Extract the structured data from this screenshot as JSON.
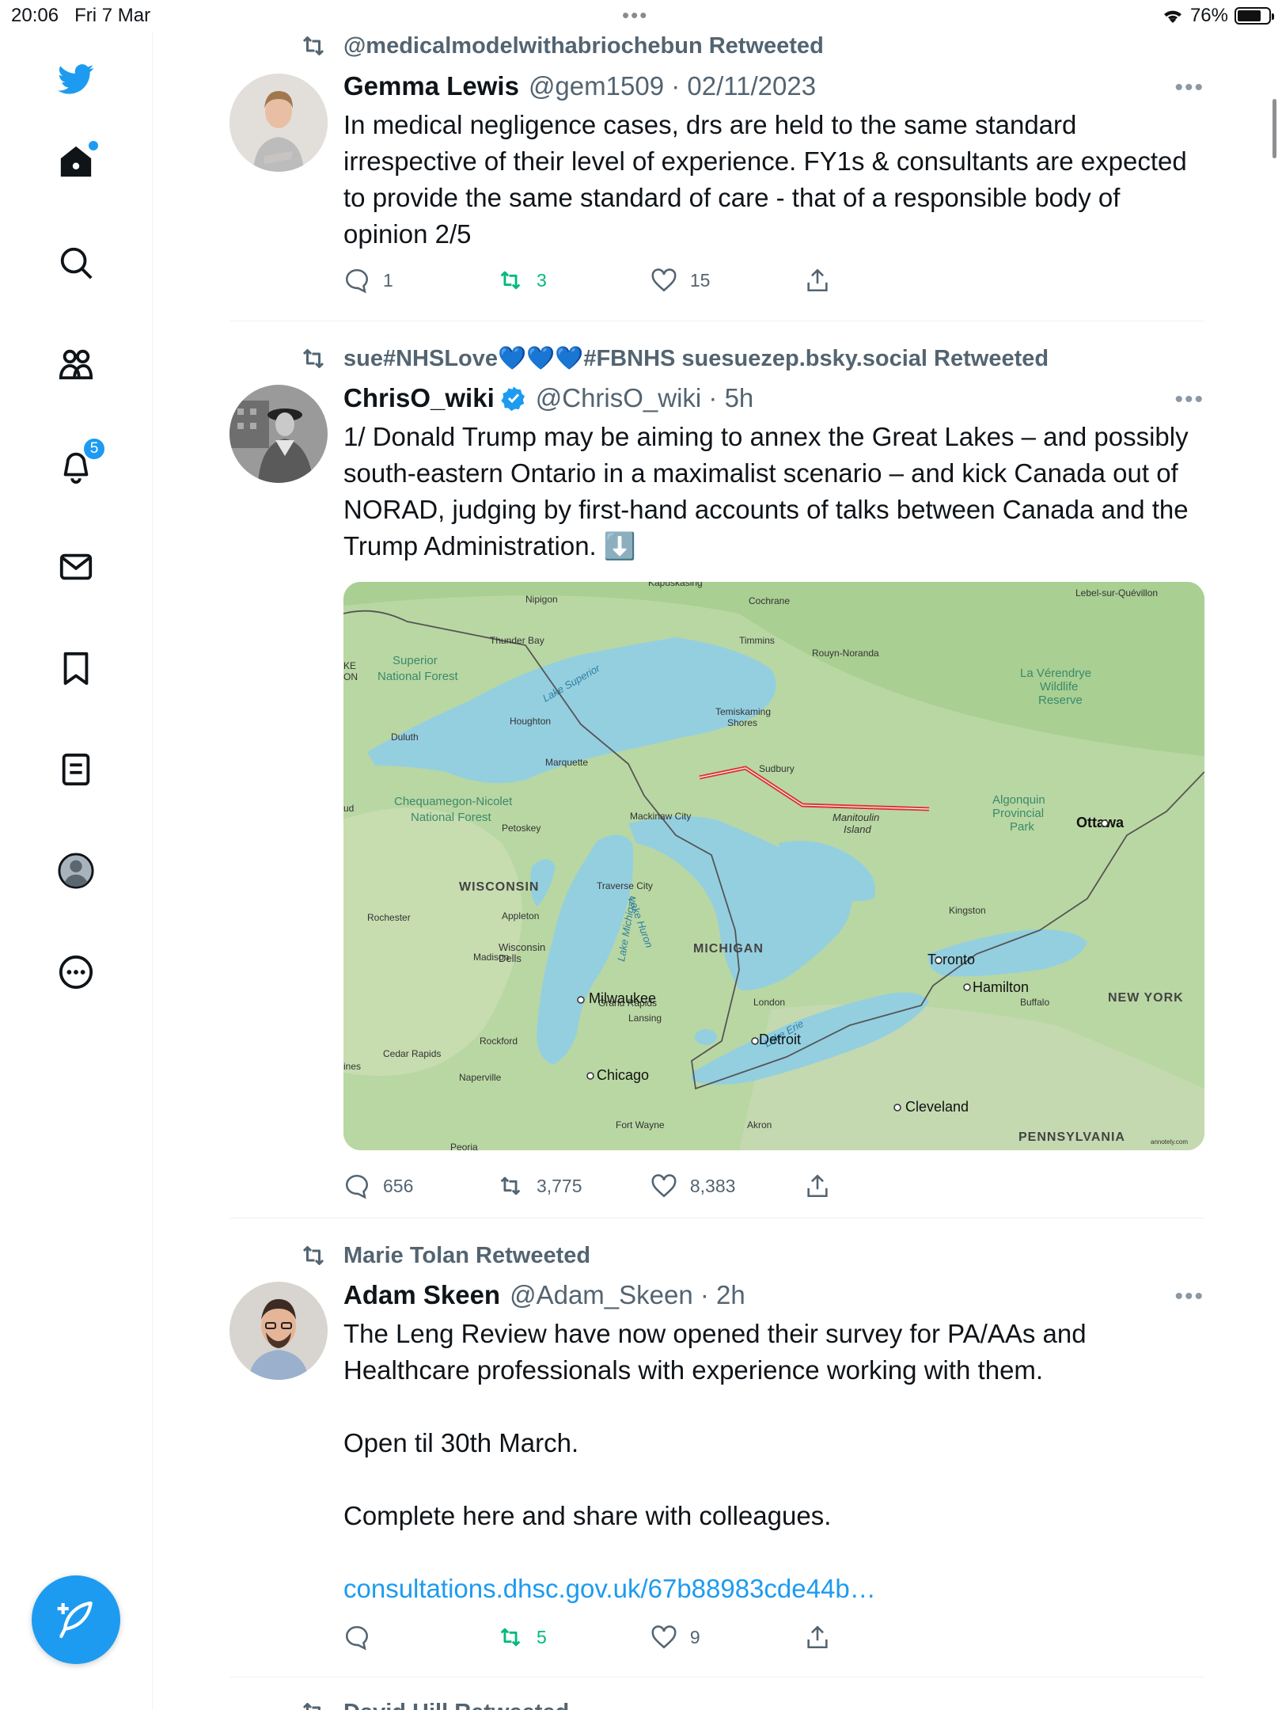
{
  "status": {
    "time": "20:06",
    "date": "Fri 7 Mar",
    "battery": "76%",
    "battery_level": 0.76
  },
  "sidebar": {
    "items": [
      {
        "name": "twitter-logo-icon"
      },
      {
        "name": "home-icon"
      },
      {
        "name": "search-icon"
      },
      {
        "name": "communities-icon"
      },
      {
        "name": "notifications-icon",
        "badge": "5"
      },
      {
        "name": "messages-icon"
      },
      {
        "name": "bookmarks-icon"
      },
      {
        "name": "lists-icon"
      },
      {
        "name": "profile-icon"
      },
      {
        "name": "more-icon"
      }
    ],
    "compose_icon": "compose-icon"
  },
  "tweets": [
    {
      "retweeted_by": "@medicalmodelwithabriochebun Retweeted",
      "name": "Gemma Lewis",
      "handle": "@gem1509 · 02/11/2023",
      "verified": false,
      "text": [
        "In medical negligence cases, drs are held to the same standard irrespective of their level of experience. FY1s & consultants are expected to provide the same standard of care - that of a responsible body of opinion 2/5"
      ],
      "replies": "1",
      "retweets": "3",
      "likes": "15"
    },
    {
      "retweeted_by": "sue#NHSLove💙💙💙#FBNHS suesuezep.bsky.social Retweeted",
      "name": "ChrisO_wiki",
      "handle": "@ChrisO_wiki · 5h",
      "verified": true,
      "text": [
        "1/ Donald Trump may be aiming to annex the Great Lakes – and possibly south-eastern Ontario in a maximalist scenario – and kick Canada out of NORAD, judging by first-hand accounts of talks between Canada and the Trump Administration. ⬇️"
      ],
      "replies": "656",
      "retweets": "3,775",
      "likes": "8,383",
      "map_labels": {
        "kapuskasing": "Kapuskasing",
        "nipigon": "Nipigon",
        "cochrane": "Cochrane",
        "lebel": "Lebel-sur-Quévillon",
        "thunder_bay": "Thunder Bay",
        "timmins": "Timmins",
        "rouyn": "Rouyn-Noranda",
        "superior_nf_1": "Superior",
        "superior_nf_2": "National Forest",
        "lake_superior": "Lake Superior",
        "la_verendrye_1": "La Vérendrye",
        "la_verendrye_2": "Wildlife",
        "la_verendrye_3": "Reserve",
        "ke": "KE",
        "on": "ON",
        "houghton": "Houghton",
        "temiskaming_1": "Temiskaming",
        "temiskaming_2": "Shores",
        "duluth": "Duluth",
        "marquette": "Marquette",
        "sudbury": "Sudbury",
        "chequamegon_1": "Chequamegon-Nicolet",
        "chequamegon_2": "National Forest",
        "ud": "ud",
        "algonquin_1": "Algonquin",
        "algonquin_2": "Provincial",
        "algonquin_3": "Park",
        "mackinaw": "Mackinaw City",
        "manitoulin_1": "Manitoulin",
        "manitoulin_2": "Island",
        "ottawa": "Ottawa",
        "petoskey": "Petoskey",
        "wisconsin": "WISCONSIN",
        "lake_huron": "Lake Huron",
        "traverse": "Traverse City",
        "kingston": "Kingston",
        "rochester": "Rochester",
        "appleton": "Appleton",
        "lake_michigan": "Lake Michigan",
        "wisconsin_dells_1": "Wisconsin",
        "wisconsin_dells_2": "Dells",
        "michigan": "MICHIGAN",
        "toronto": "Toronto",
        "madison": "Madison",
        "milwaukee": "Milwaukee",
        "hamilton": "Hamilton",
        "new_york": "NEW YORK",
        "grand_rapids": "Grand Rapids",
        "london": "London",
        "buffalo": "Buffalo",
        "lansing": "Lansing",
        "rockford": "Rockford",
        "detroit": "Detroit",
        "cedar_rapids": "Cedar Rapids",
        "lake_erie": "Lake Erie",
        "ines": "ines",
        "naperville": "Naperville",
        "chicago": "Chicago",
        "cleveland": "Cleveland",
        "fort_wayne": "Fort Wayne",
        "akron": "Akron",
        "pennsylvania": "PENNSYLVANIA",
        "peoria": "Peoria",
        "watermark": "annotely.com"
      }
    },
    {
      "retweeted_by": "Marie Tolan Retweeted",
      "name": "Adam Skeen",
      "handle": "@Adam_Skeen · 2h",
      "verified": false,
      "text": [
        "The Leng Review have now opened their survey for PA/AAs and Healthcare professionals with experience working with them.",
        "Open til 30th March.",
        "Complete here and share with colleagues."
      ],
      "link": "consultations.dhsc.gov.uk/67b88983cde44b…",
      "replies": "",
      "retweets": "5",
      "likes": "9"
    }
  ],
  "next_tweet": {
    "retweeted_by": "David Hill Retweeted"
  }
}
